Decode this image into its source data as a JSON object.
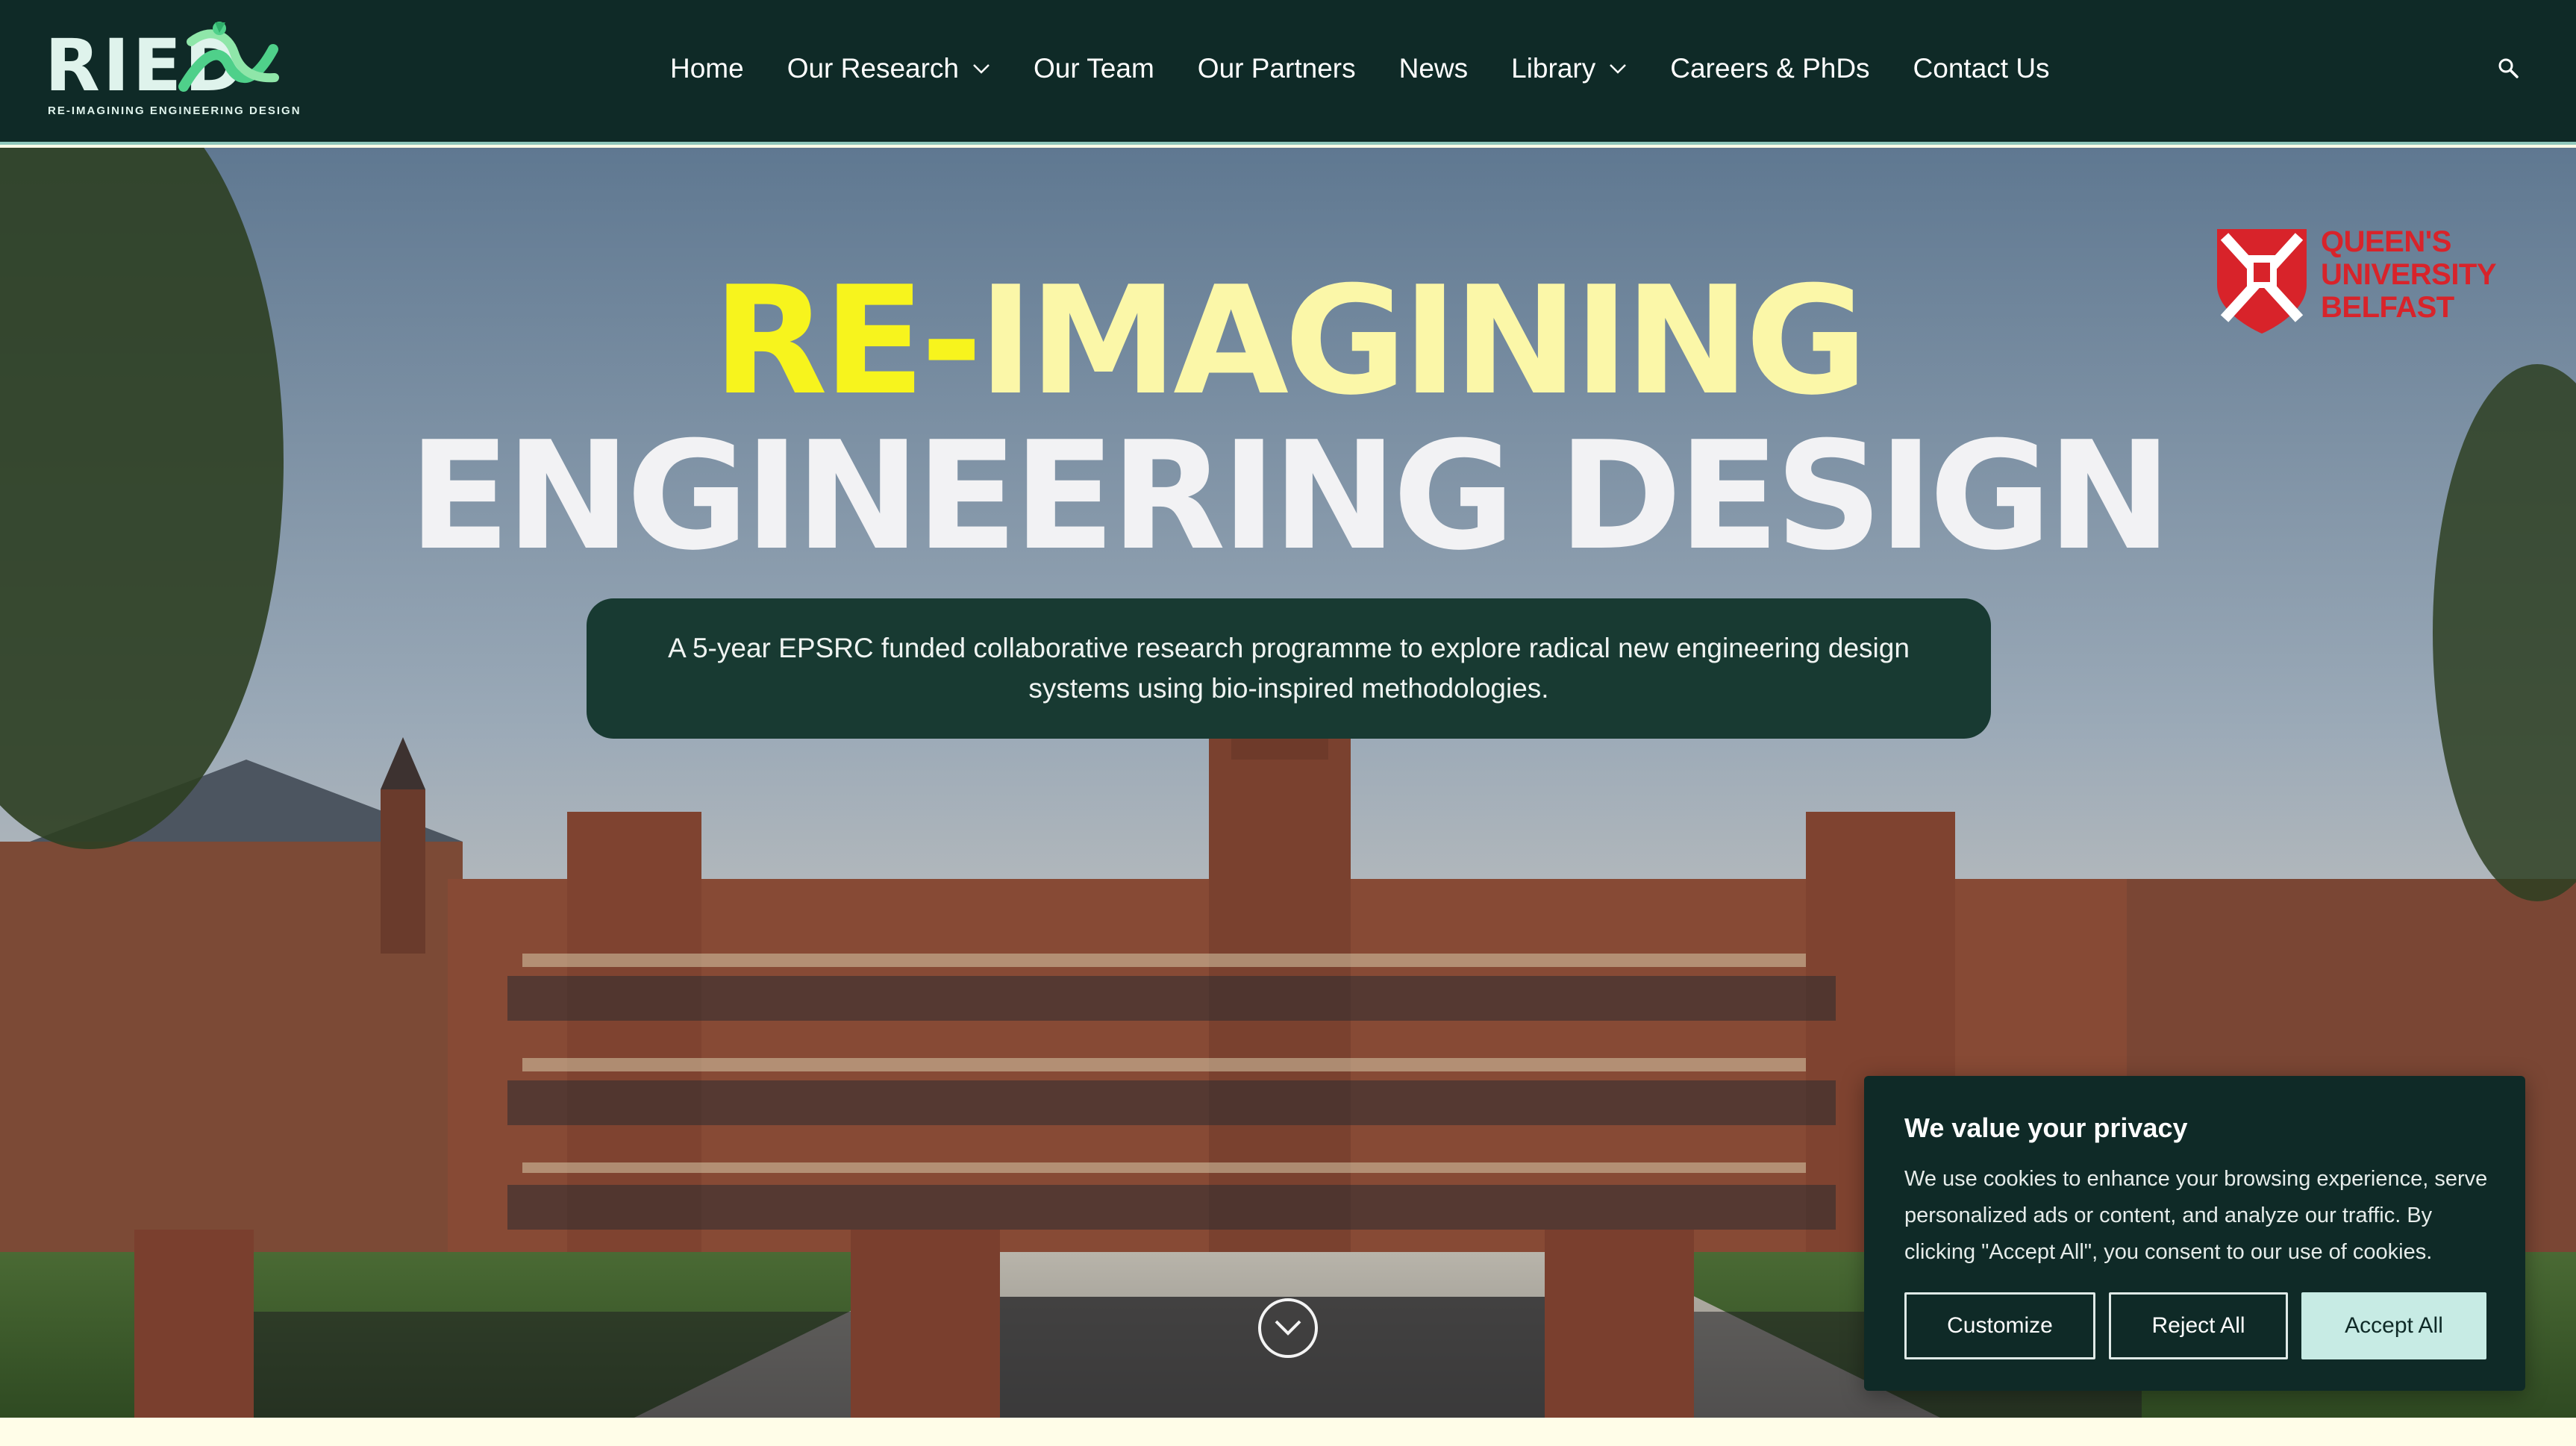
{
  "header": {
    "logo": {
      "wordmark": "RIED",
      "tagline": "RE-IMAGINING ENGINEERING DESIGN"
    },
    "nav": [
      {
        "label": "Home",
        "has_dropdown": false
      },
      {
        "label": "Our Research",
        "has_dropdown": true
      },
      {
        "label": "Our Team",
        "has_dropdown": false
      },
      {
        "label": "Our Partners",
        "has_dropdown": false
      },
      {
        "label": "News",
        "has_dropdown": false
      },
      {
        "label": "Library",
        "has_dropdown": true
      },
      {
        "label": "Careers & PhDs",
        "has_dropdown": false
      },
      {
        "label": "Contact Us",
        "has_dropdown": false
      }
    ],
    "search_icon": "search-icon"
  },
  "hero": {
    "title_part1_highlight": "RE-",
    "title_part1_rest": "IMAGINING",
    "title_line2": "ENGINEERING DESIGN",
    "tagline": "A 5-year EPSRC funded collaborative research programme to explore radical new engineering design systems using bio-inspired methodologies.",
    "partner_logo": {
      "line1": "QUEEN'S",
      "line2": "UNIVERSITY",
      "line3": "BELFAST"
    },
    "scroll_icon": "chevron-down-circle-icon"
  },
  "cookie_banner": {
    "title": "We value your privacy",
    "text": "We use cookies to enhance your browsing experience, serve personalized ads or content, and analyze our traffic. By clicking \"Accept All\", you consent to our use of cookies.",
    "buttons": {
      "customize": "Customize",
      "reject": "Reject All",
      "accept": "Accept All"
    }
  },
  "colors": {
    "header_bg": "#0f2a27",
    "accent_mint": "#c7ebe4",
    "title_yellow": "#f7f41d",
    "title_cream": "#fbf7a8",
    "qub_red": "#d8232a"
  }
}
